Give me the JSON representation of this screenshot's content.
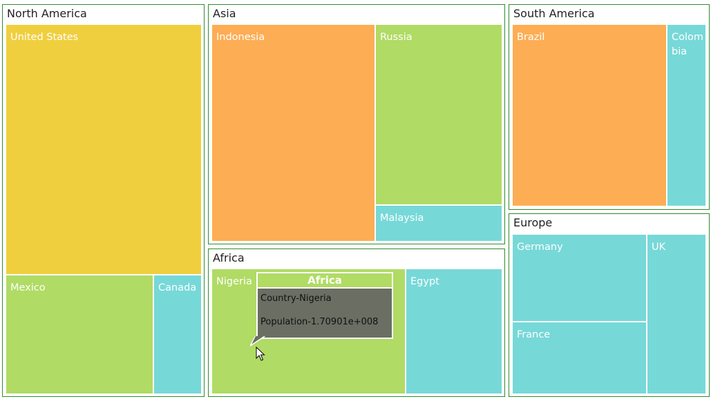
{
  "chart_data": {
    "type": "treemap",
    "groups": [
      {
        "name": "North America",
        "items": [
          {
            "label": "United States",
            "color": "#f0cf3f"
          },
          {
            "label": "Mexico",
            "color": "#b0db64"
          },
          {
            "label": "Canada",
            "color": "#77d8d8"
          }
        ]
      },
      {
        "name": "Asia",
        "items": [
          {
            "label": "Indonesia",
            "color": "#fdad54"
          },
          {
            "label": "Russia",
            "color": "#b0db64"
          },
          {
            "label": "Malaysia",
            "color": "#77d8d8"
          }
        ]
      },
      {
        "name": "South America",
        "items": [
          {
            "label": "Brazil",
            "color": "#fdad54"
          },
          {
            "label": "Colombia",
            "color": "#77d8d8"
          }
        ]
      },
      {
        "name": "Africa",
        "items": [
          {
            "label": "Nigeria",
            "color": "#b0db64"
          },
          {
            "label": "Egypt",
            "color": "#77d8d8"
          }
        ]
      },
      {
        "name": "Europe",
        "items": [
          {
            "label": "Germany",
            "color": "#77d8d8"
          },
          {
            "label": "UK",
            "color": "#77d8d8"
          },
          {
            "label": "France",
            "color": "#77d8d8"
          }
        ]
      }
    ]
  },
  "tooltip": {
    "title": "Africa",
    "line1": "Country-Nigeria",
    "line2": "Population-1.70901e+008"
  }
}
